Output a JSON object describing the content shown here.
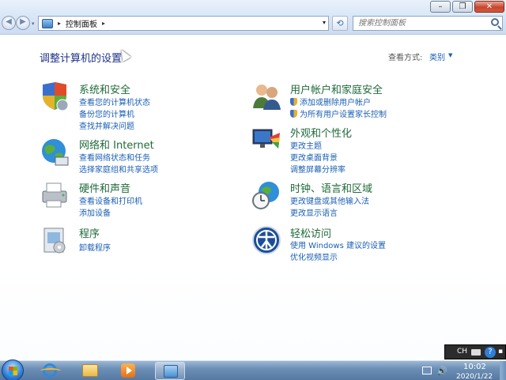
{
  "window": {
    "controls": {
      "minimize": "–",
      "maximize": "❐",
      "close": "✕"
    },
    "nav": {
      "back": "◀",
      "forward": "▶",
      "dropdown": "▾"
    },
    "address": {
      "separator": "▸",
      "path": "控制面板",
      "separator2": "▸",
      "dropdown": "▾"
    },
    "refresh_glyph": "⟲",
    "search": {
      "placeholder": "搜索控制面板"
    }
  },
  "content": {
    "page_title": "调整计算机的设置",
    "view_by_label": "查看方式:",
    "view_by_value": "类别",
    "view_by_caret": "▼",
    "categories": [
      {
        "title": "系统和安全",
        "links": [
          "查看您的计算机状态",
          "备份您的计算机",
          "查找并解决问题"
        ]
      },
      {
        "title": "网络和 Internet",
        "links": [
          "查看网络状态和任务",
          "选择家庭组和共享选项"
        ]
      },
      {
        "title": "硬件和声音",
        "links": [
          "查看设备和打印机",
          "添加设备"
        ]
      },
      {
        "title": "程序",
        "links": [
          "卸载程序"
        ]
      },
      {
        "title": "用户帐户和家庭安全",
        "links": [
          "添加或删除用户帐户",
          "为所有用户设置家长控制"
        ]
      },
      {
        "title": "外观和个性化",
        "links": [
          "更改主题",
          "更改桌面背景",
          "调整屏幕分辨率"
        ]
      },
      {
        "title": "时钟、语言和区域",
        "links": [
          "更改键盘或其他输入法",
          "更改显示语言"
        ]
      },
      {
        "title": "轻松访问",
        "links": [
          "使用 Windows 建议的设置",
          "优化视频显示"
        ]
      }
    ]
  },
  "language_bar": {
    "lang": "CH",
    "help": "?"
  },
  "taskbar": {
    "clock_time": "10:02",
    "clock_date": "2020/1/22"
  },
  "colors": {
    "category_title": "#1f6a3a",
    "link": "#1a5fb4",
    "page_title": "#1e3287"
  }
}
